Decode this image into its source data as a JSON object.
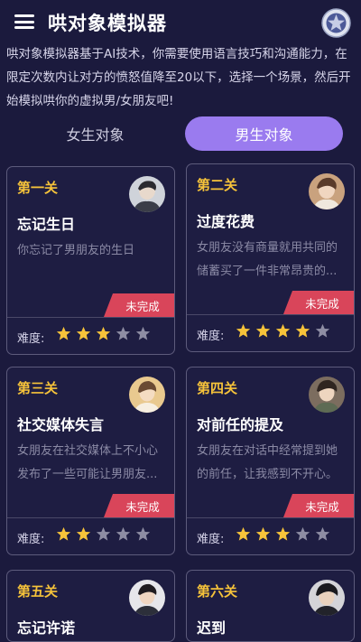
{
  "header": {
    "title": "哄对象模拟器",
    "menu_icon": "menu-icon",
    "badge_icon": "badge-icon"
  },
  "intro": "哄对象模拟器基于AI技术，你需要使用语言技巧和沟通能力，在限定次数内让对方的愤怒值降至20以下，选择一个场景，然后开始模拟哄你的虚拟男/女朋友吧!",
  "tabs": [
    {
      "label": "女生对象",
      "active": false
    },
    {
      "label": "男生对象",
      "active": true
    }
  ],
  "difficulty_label": "难度:",
  "colors": {
    "accent": "#9a7bef",
    "level": "#f6c33a",
    "status": "#d9455a",
    "star_on": "#f6c33a",
    "star_off": "#8e8da3",
    "background": "#1b1a3d"
  },
  "cards": [
    {
      "level": "第一关",
      "name": "忘记生日",
      "desc": "你忘记了男朋友的生日",
      "status": "未完成",
      "stars": 3
    },
    {
      "level": "第二关",
      "name": "过度花费",
      "desc": "女朋友没有商量就用共同的储蓄买了一件非常昂贵的...",
      "status": "未完成",
      "stars": 4
    },
    {
      "level": "第三关",
      "name": "社交媒体失言",
      "desc": "女朋友在社交媒体上不小心发布了一些可能让男朋友...",
      "status": "未完成",
      "stars": 2
    },
    {
      "level": "第四关",
      "name": "对前任的提及",
      "desc": "女朋友在对话中经常提到她的前任，让我感到不开心。",
      "status": "未完成",
      "stars": 3
    }
  ],
  "peek_cards": [
    {
      "level": "第五关",
      "name": "忘记许诺"
    },
    {
      "level": "第六关",
      "name": "迟到"
    }
  ]
}
